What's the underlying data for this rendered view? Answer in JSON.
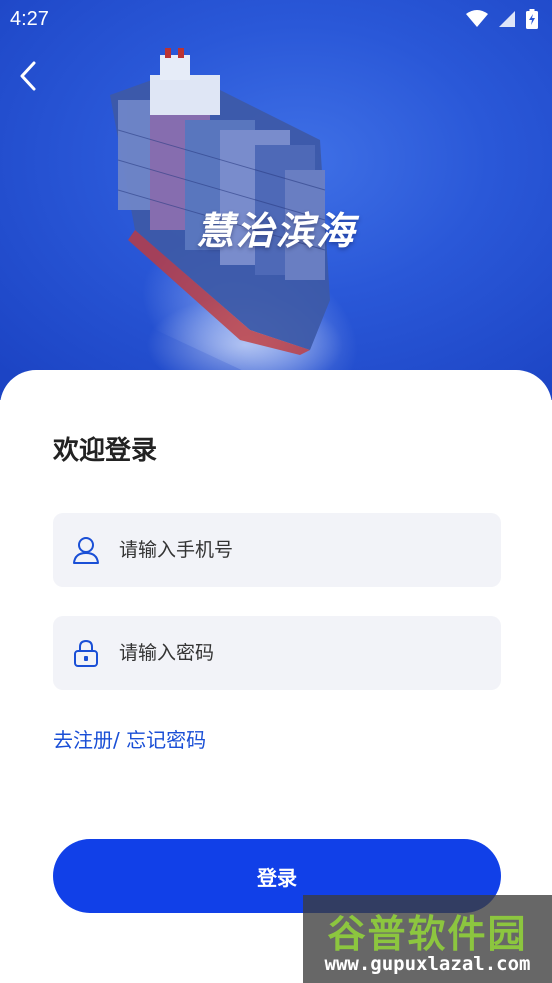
{
  "status_bar": {
    "time": "4:27",
    "icons": [
      "wifi-icon",
      "signal-icon",
      "battery-charging-icon"
    ]
  },
  "hero": {
    "title": "慧治滨海",
    "background": "container-ship-at-sea"
  },
  "nav": {
    "back_icon": "chevron-left-icon"
  },
  "login": {
    "heading": "欢迎登录",
    "phone": {
      "placeholder": "请输入手机号",
      "value": "",
      "icon": "user-icon"
    },
    "password": {
      "placeholder": "请输入密码",
      "value": "",
      "icon": "lock-icon"
    },
    "register_link": "去注册/",
    "forgot_link": "忘记密码",
    "submit_label": "登录"
  },
  "watermark": {
    "title": "谷普软件园",
    "url": "www.gupuxlazal.com"
  },
  "colors": {
    "accent": "#1140e8",
    "link": "#1a4fd6",
    "field_bg": "#f2f3f8",
    "hero_blue": "#2a58d8"
  }
}
